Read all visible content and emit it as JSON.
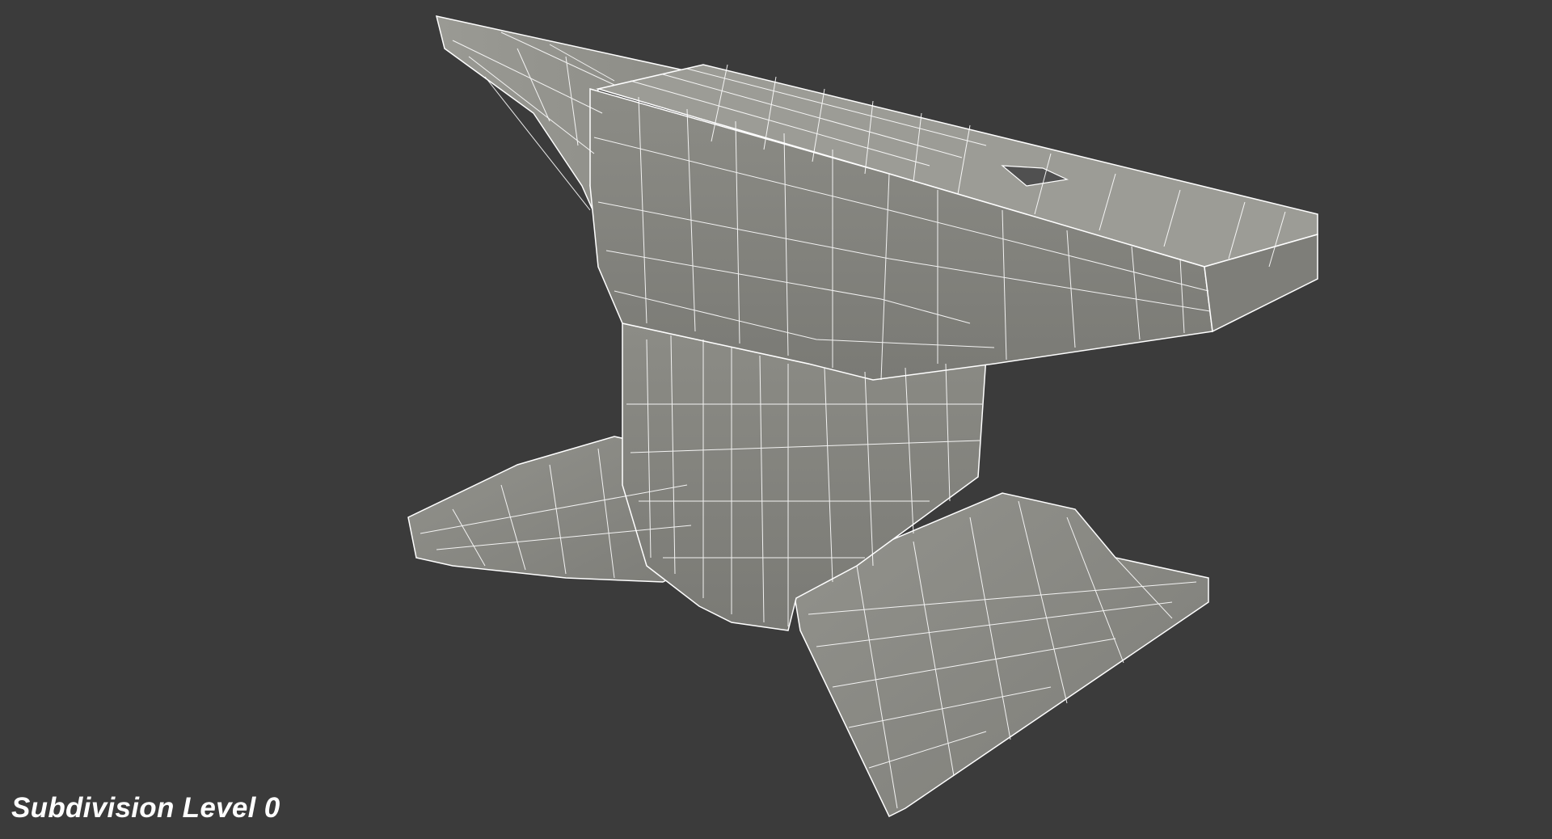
{
  "viewport": {
    "background_color": "#3b3b3b",
    "mesh_fill_color": "#8a8a84",
    "mesh_shadow_color": "#74746f",
    "mesh_highlight_color": "#a3a39c",
    "wire_color": "#ffffff",
    "subject_icon": "anvil-wireframe-icon"
  },
  "caption": {
    "text": "Subdivision Level 0"
  }
}
